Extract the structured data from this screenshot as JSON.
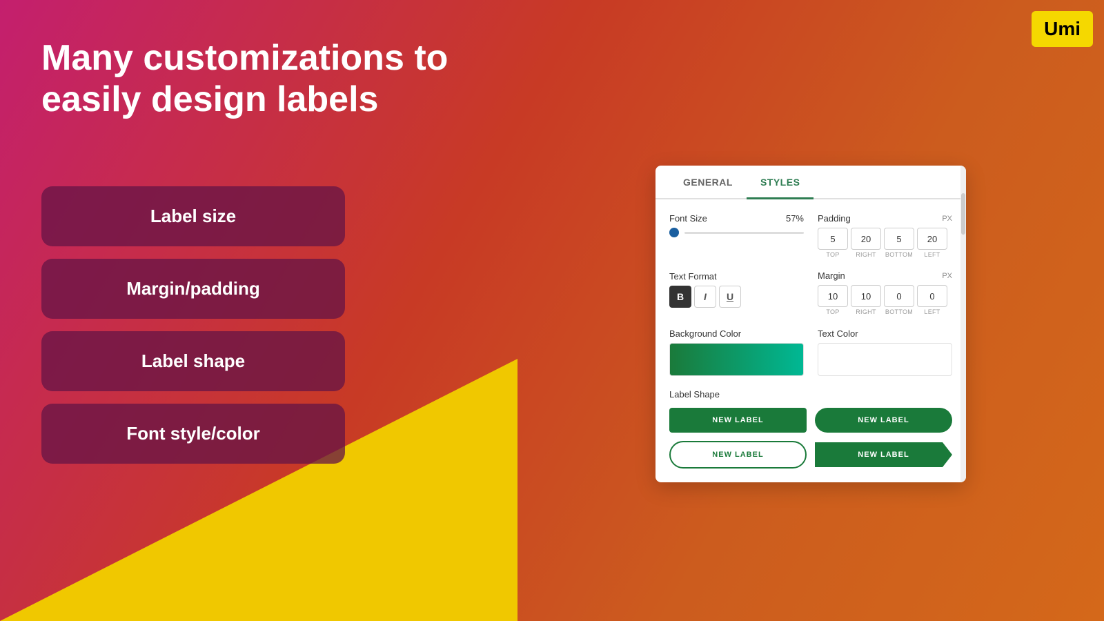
{
  "app": {
    "logo": "Umi",
    "title_line1": "Many customizations to",
    "title_line2": "easily design labels"
  },
  "feature_cards": [
    {
      "id": "label-size",
      "label": "Label size"
    },
    {
      "id": "margin-padding",
      "label": "Margin/padding"
    },
    {
      "id": "label-shape",
      "label": "Label shape"
    },
    {
      "id": "font-style-color",
      "label": "Font style/color"
    }
  ],
  "panel": {
    "tabs": [
      {
        "id": "general",
        "label": "GENERAL",
        "active": false
      },
      {
        "id": "styles",
        "label": "STYLES",
        "active": true
      }
    ],
    "font_size": {
      "label": "Font Size",
      "value": "57%"
    },
    "padding": {
      "label": "Padding",
      "unit": "PX",
      "top": "5",
      "right": "20",
      "bottom": "5",
      "left": "20",
      "sub_labels": [
        "TOP",
        "RIGHT",
        "BOTTOM",
        "LEFT"
      ]
    },
    "text_format": {
      "label": "Text Format",
      "bold": "B",
      "italic": "I",
      "underline": "U"
    },
    "margin": {
      "label": "Margin",
      "unit": "PX",
      "top": "10",
      "right": "10",
      "bottom": "0",
      "left": "0",
      "sub_labels": [
        "TOP",
        "RIGHT",
        "BOTTOM",
        "LEFT"
      ]
    },
    "background_color": {
      "label": "Background Color"
    },
    "text_color": {
      "label": "Text Color"
    },
    "label_shape": {
      "label": "Label Shape",
      "shapes": [
        {
          "id": "square",
          "label": "NEW LABEL",
          "style": "square"
        },
        {
          "id": "rounded",
          "label": "NEW LABEL",
          "style": "rounded"
        },
        {
          "id": "pill-outline",
          "label": "NEW LABEL",
          "style": "pill-outline"
        },
        {
          "id": "cut",
          "label": "NEW LABEL",
          "style": "cut"
        }
      ]
    }
  }
}
